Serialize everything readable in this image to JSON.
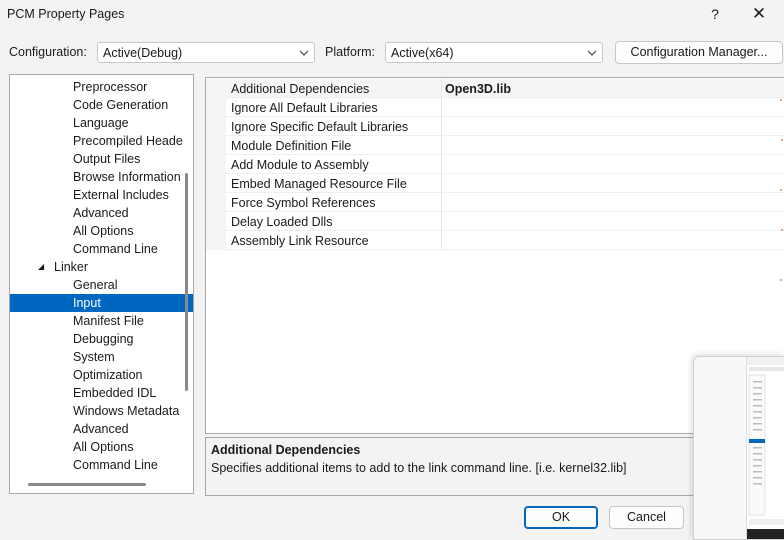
{
  "window": {
    "title": "PCM Property Pages",
    "help_glyph": "?",
    "close_glyph": "✕"
  },
  "config": {
    "label": "Configuration:",
    "value": "Active(Debug)"
  },
  "platform": {
    "label": "Platform:",
    "value": "Active(x64)"
  },
  "config_manager_label": "Configuration Manager...",
  "tree": {
    "items": [
      {
        "label": "Preprocessor"
      },
      {
        "label": "Code Generation"
      },
      {
        "label": "Language"
      },
      {
        "label": "Precompiled Heade"
      },
      {
        "label": "Output Files"
      },
      {
        "label": "Browse Information"
      },
      {
        "label": "External Includes"
      },
      {
        "label": "Advanced"
      },
      {
        "label": "All Options"
      },
      {
        "label": "Command Line"
      },
      {
        "label": "Linker",
        "expander": "◢"
      },
      {
        "label": "General"
      },
      {
        "label": "Input"
      },
      {
        "label": "Manifest File"
      },
      {
        "label": "Debugging"
      },
      {
        "label": "System"
      },
      {
        "label": "Optimization"
      },
      {
        "label": "Embedded IDL"
      },
      {
        "label": "Windows Metadata"
      },
      {
        "label": "Advanced"
      },
      {
        "label": "All Options"
      },
      {
        "label": "Command Line"
      }
    ]
  },
  "properties": [
    {
      "name": "Additional Dependencies",
      "value": "Open3D.lib"
    },
    {
      "name": "Ignore All Default Libraries",
      "value": ""
    },
    {
      "name": "Ignore Specific Default Libraries",
      "value": ""
    },
    {
      "name": "Module Definition File",
      "value": ""
    },
    {
      "name": "Add Module to Assembly",
      "value": ""
    },
    {
      "name": "Embed Managed Resource File",
      "value": ""
    },
    {
      "name": "Force Symbol References",
      "value": ""
    },
    {
      "name": "Delay Loaded Dlls",
      "value": ""
    },
    {
      "name": "Assembly Link Resource",
      "value": ""
    }
  ],
  "description": {
    "title": "Additional Dependencies",
    "text": "Specifies additional items to add to the link command line. [i.e. kernel32.lib]"
  },
  "buttons": {
    "ok": "OK",
    "cancel": "Cancel"
  },
  "colors": {
    "selection": "#0067c0",
    "accent_border": "#0067c0"
  }
}
